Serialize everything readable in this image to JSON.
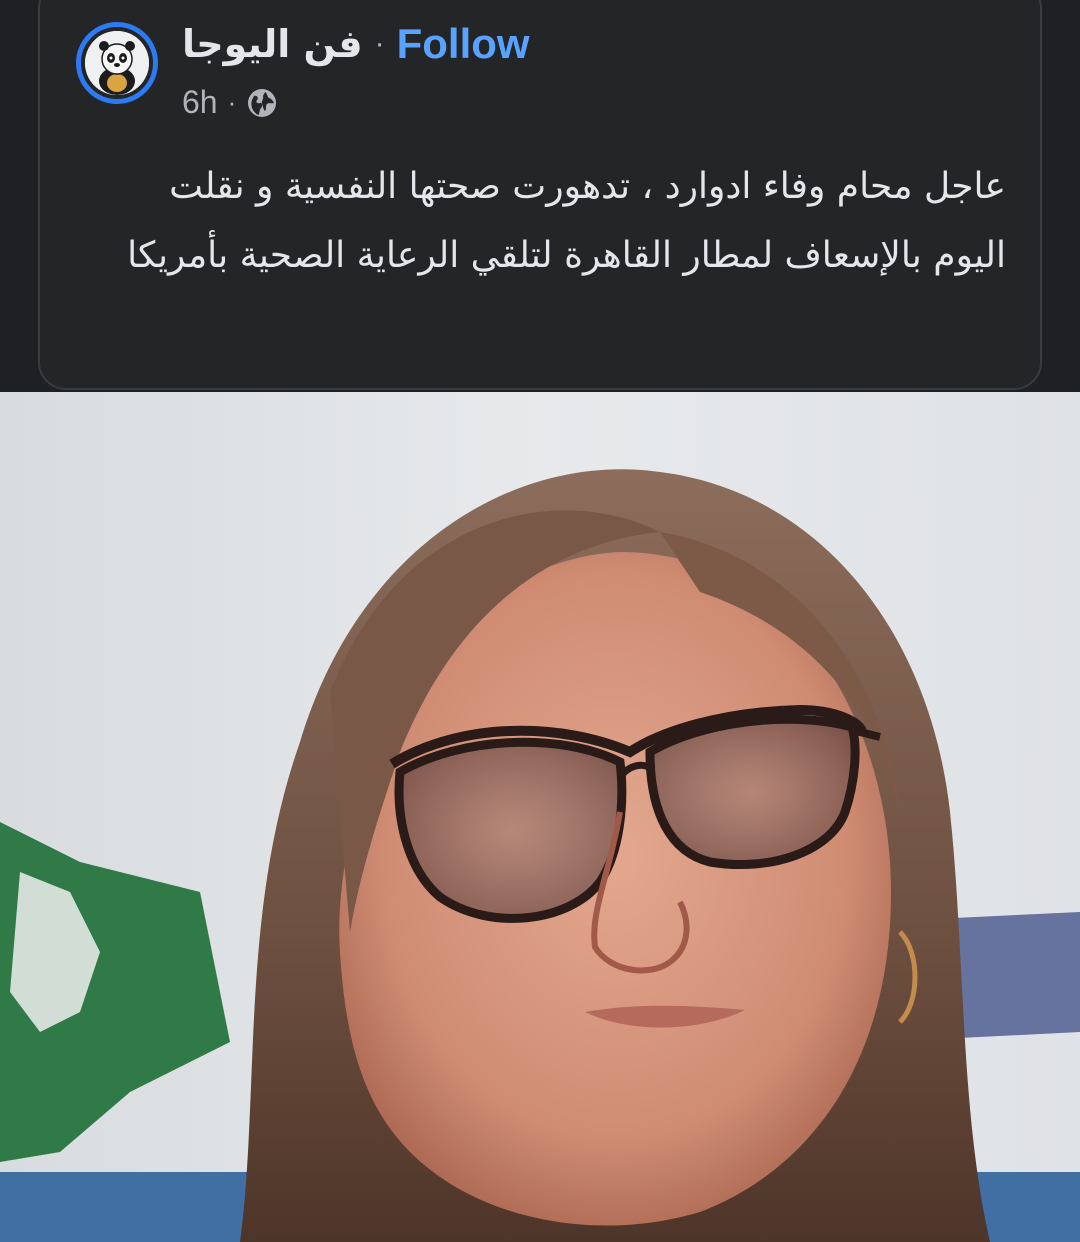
{
  "post": {
    "page_name": "فن اليوجا",
    "separator": "·",
    "follow_label": "Follow",
    "time": "6h",
    "time_separator": "·",
    "privacy_icon": "globe-icon",
    "text": "عاجل محام وفاء ادوارد ، تدهورت صحتها النفسية و نقلت اليوم بالإسعاف لمطار القاهرة لتلقي الرعاية الصحية بأمريكا",
    "avatar_icon": "panda-avatar",
    "photo": "portrait of a woman with glasses"
  },
  "colors": {
    "background": "#1f2023",
    "card": "#242526",
    "text_primary": "#e4e6eb",
    "text_secondary": "#b0b3b8",
    "follow": "#5aa2ff",
    "avatar_ring": "#2d7bf4"
  }
}
